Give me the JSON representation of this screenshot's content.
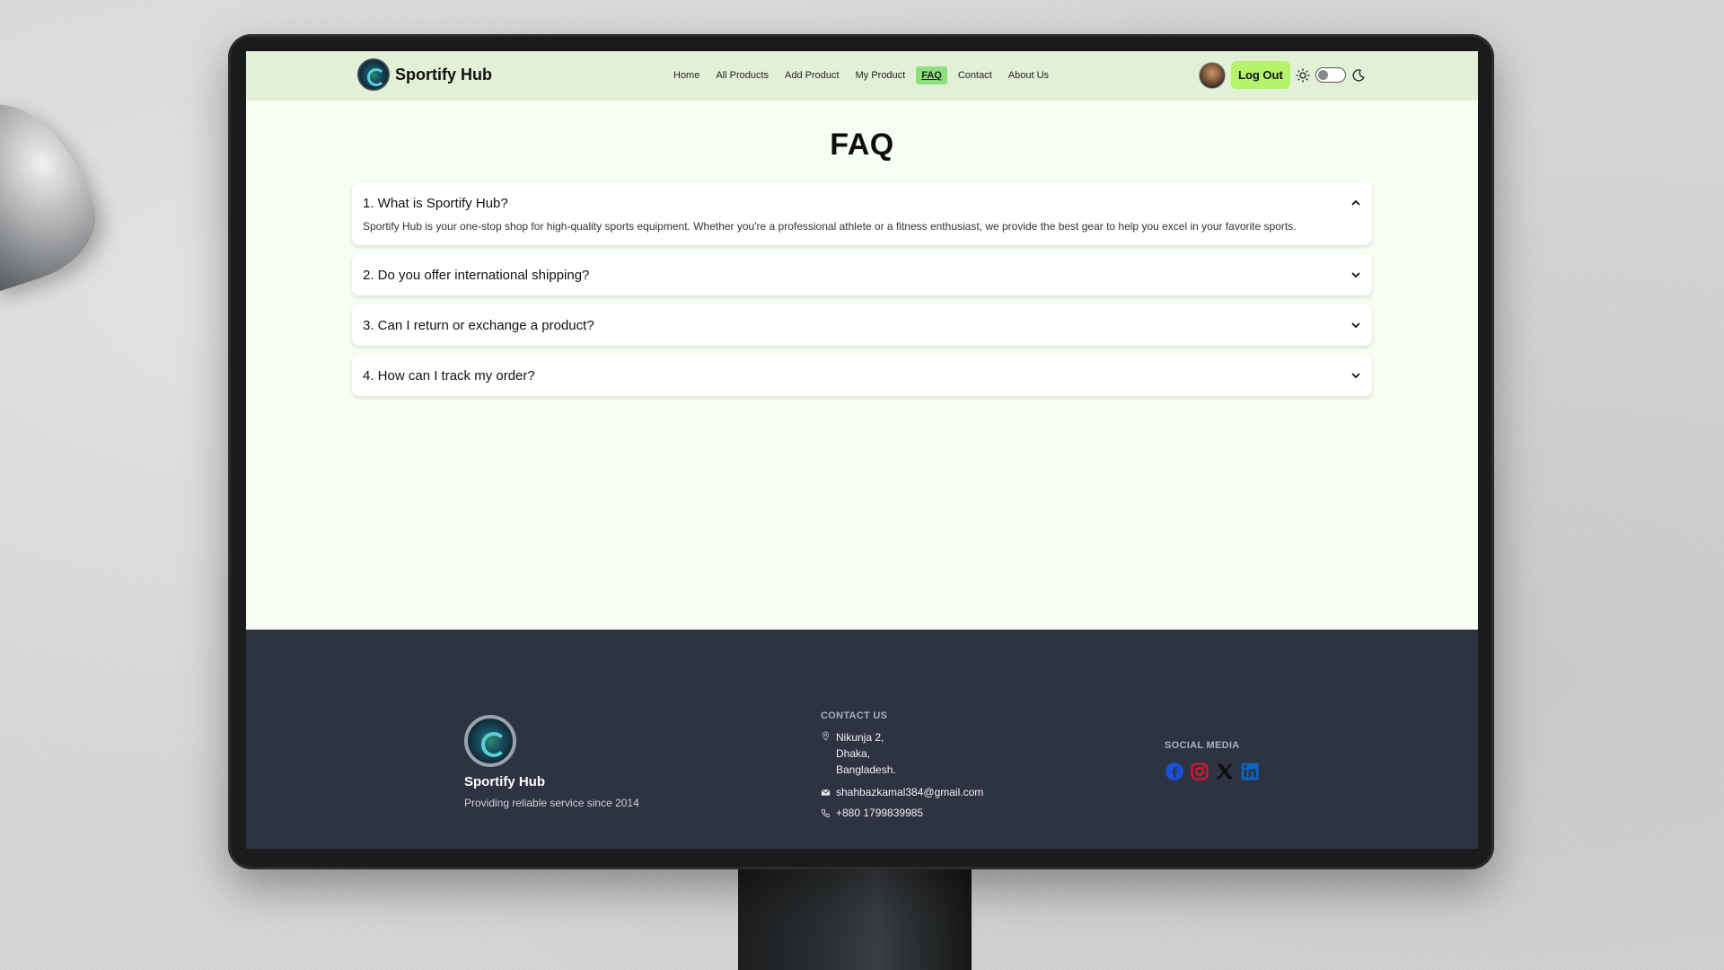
{
  "navbar": {
    "brand": "Sportify Hub",
    "links": [
      "Home",
      "All Products",
      "Add Product",
      "My Product",
      "FAQ",
      "Contact",
      "About Us"
    ],
    "active_link": "FAQ",
    "logout_label": "Log Out"
  },
  "page": {
    "title": "FAQ"
  },
  "faq": [
    {
      "question": "1. What is Sportify Hub?",
      "answer": "Sportify Hub is your one-stop shop for high-quality sports equipment. Whether you're a professional athlete or a fitness enthusiast, we provide the best gear to help you excel in your favorite sports.",
      "expanded": true
    },
    {
      "question": "2. Do you offer international shipping?",
      "expanded": false
    },
    {
      "question": "3. Can I return or exchange a product?",
      "expanded": false
    },
    {
      "question": "4. How can I track my order?",
      "expanded": false
    }
  ],
  "footer": {
    "brand": "Sportify Hub",
    "tagline": "Providing reliable service since 2014",
    "contact_title": "CONTACT US",
    "address": [
      "Nikunja 2,",
      "Dhaka,",
      "Bangladesh."
    ],
    "email": "shahbazkamal384@gmail.com",
    "phone": "+880 1799839985",
    "social_title": "SOCIAL MEDIA",
    "social": [
      "facebook-icon",
      "instagram-icon",
      "x-icon",
      "linkedin-icon"
    ]
  },
  "colors": {
    "navbar_bg": "#e2f0d6",
    "active_link_bg": "#8de07e",
    "logout_bg": "#b4f36a",
    "footer_bg": "#2d3340"
  }
}
